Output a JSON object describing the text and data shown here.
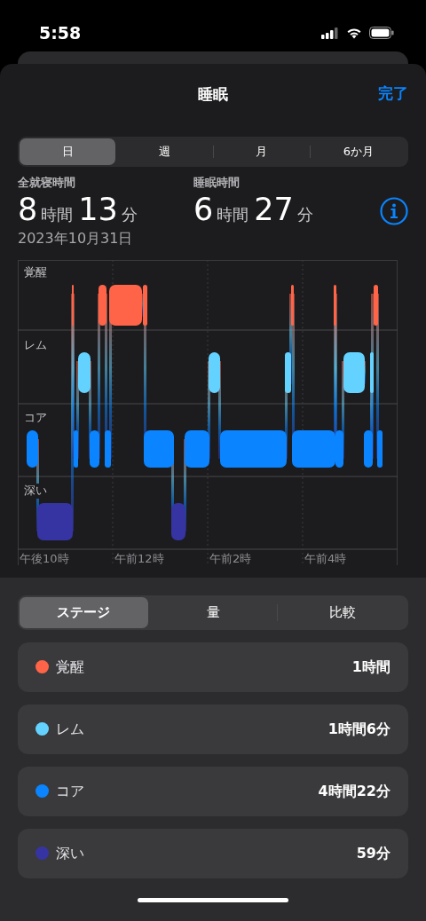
{
  "status_bar": {
    "time": "5:58"
  },
  "header": {
    "title": "睡眠",
    "done": "完了"
  },
  "range_tabs": [
    {
      "label": "日",
      "selected": true
    },
    {
      "label": "週",
      "selected": false
    },
    {
      "label": "月",
      "selected": false
    },
    {
      "label": "6か月",
      "selected": false
    }
  ],
  "summary": [
    {
      "label": "全就寝時間",
      "hours": "8",
      "hours_unit": "時間",
      "minutes": "13",
      "minutes_unit": "分"
    },
    {
      "label": "睡眠時間",
      "hours": "6",
      "hours_unit": "時間",
      "minutes": "27",
      "minutes_unit": "分"
    }
  ],
  "date": "2023年10月31日",
  "chart": {
    "stage_labels": [
      "覚醒",
      "レム",
      "コア",
      "深い"
    ],
    "time_labels": [
      "午後10時",
      "午前12時",
      "午前2時",
      "午前4時"
    ]
  },
  "view_tabs": [
    {
      "label": "ステージ",
      "selected": true
    },
    {
      "label": "量",
      "selected": false
    },
    {
      "label": "比較",
      "selected": false
    }
  ],
  "stages": [
    {
      "name": "覚醒",
      "duration": "1時間",
      "color": "#ff6448"
    },
    {
      "name": "レム",
      "duration": "1時間6分",
      "color": "#64d2ff"
    },
    {
      "name": "コア",
      "duration": "4時間22分",
      "color": "#0a84ff"
    },
    {
      "name": "深い",
      "duration": "59分",
      "color": "#3634a3"
    }
  ]
}
